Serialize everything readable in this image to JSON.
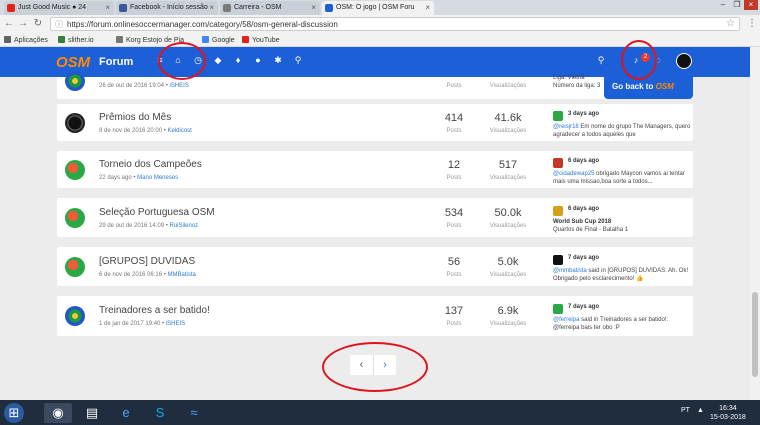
{
  "browser": {
    "tabs": [
      {
        "title": "Just Good Music ● 24",
        "color": "#e62117"
      },
      {
        "title": "Facebook - Início sessão",
        "color": "#3b5998"
      },
      {
        "title": "Carreira - OSM",
        "color": "#7a7a7a"
      },
      {
        "title": "OSM: O jogo | OSM Foru",
        "color": "#1c5fd6"
      }
    ],
    "url": "https://forum.onlinesoccermanager.com/category/58/osm-general-discussion",
    "bookmarks": [
      {
        "label": "Aplicações",
        "color": "#5f6368"
      },
      {
        "label": "slither.io",
        "color": "#3a7a3a"
      },
      {
        "label": "Korg Estojo de Pia",
        "color": "#777777"
      },
      {
        "label": "Google",
        "color": "#4285f4"
      },
      {
        "label": "YouTube",
        "color": "#e62117"
      }
    ]
  },
  "header": {
    "logo": "OSM",
    "title": "Forum",
    "notification_count": "2"
  },
  "goback": {
    "text": "Go back to",
    "brand": "OSM"
  },
  "partial_row": {
    "meta": "26 de out de 2016 19:04",
    "author": "iSHEIS",
    "posts_label": "Posts",
    "views_label": "Visualizações",
    "last_line1": "Liga: Vietnã",
    "last_line2": "Número da liga: 3"
  },
  "categories": [
    {
      "name": "Prêmios do Mês",
      "date": "8 de nov de 2016 20:00",
      "author": "Keldicost",
      "icon": "dark",
      "posts": "414",
      "posts_label": "Posts",
      "views": "41.6k",
      "views_label": "Visualizações",
      "last_time": "3 days ago",
      "last_user": "@reisjr18",
      "last_text": " Em nome do grupo The Managers, quero agradecer a todos aqueles que",
      "last_color": "#2aa845"
    },
    {
      "name": "Torneio dos Campeões",
      "date": "22 days ago",
      "author": "Mano Meneses",
      "icon": "green",
      "posts": "12",
      "posts_label": "Posts",
      "views": "517",
      "views_label": "Visualizações",
      "last_time": "6 days ago",
      "last_user": "@cidadewap25",
      "last_text": " obrigado Maycon vamos ai tentar mais uma missao,boa sorte a todos...",
      "last_color": "#c0392b"
    },
    {
      "name": "Seleção Portuguesa OSM",
      "date": "29 de out de 2016 14:09",
      "author": "RuiSilenoz",
      "icon": "green",
      "posts": "534",
      "posts_label": "Posts",
      "views": "50.0k",
      "views_label": "Visualizações",
      "last_time": "6 days ago",
      "last_user": "World Sub Cup 2018",
      "last_text": "Quartos de Final - Batalha 1",
      "last_color": "#d4a017"
    },
    {
      "name": "[GRUPOS] DUVIDAS",
      "date": "6 de nov de 2016 06:16",
      "author": "MMBatista",
      "icon": "green",
      "posts": "56",
      "posts_label": "Posts",
      "views": "5.0k",
      "views_label": "Visualizações",
      "last_time": "7 days ago",
      "last_user": "@mmbatista",
      "last_text": " said in [GRUPOS] DUVIDAS: Ah. Ok! Obrigado pelo esclarecimento! 👍",
      "last_color": "#111111"
    },
    {
      "name": "Treinadores a ser batido!",
      "date": "1 de jan de 2017 19:40",
      "author": "iSHEIS",
      "icon": "blue",
      "posts": "137",
      "posts_label": "Posts",
      "views": "6.9k",
      "views_label": "Visualizações",
      "last_time": "7 days ago",
      "last_user": "@ferreipa",
      "last_text": " said in Treinadores a ser batido!: @ferreipa bais ter obo :P",
      "last_color": "#2aa845"
    }
  ],
  "pagination": {
    "prev": "‹",
    "next": "›"
  },
  "taskbar": {
    "lang": "PT",
    "time": "16:34",
    "date": "15-03-2018"
  }
}
